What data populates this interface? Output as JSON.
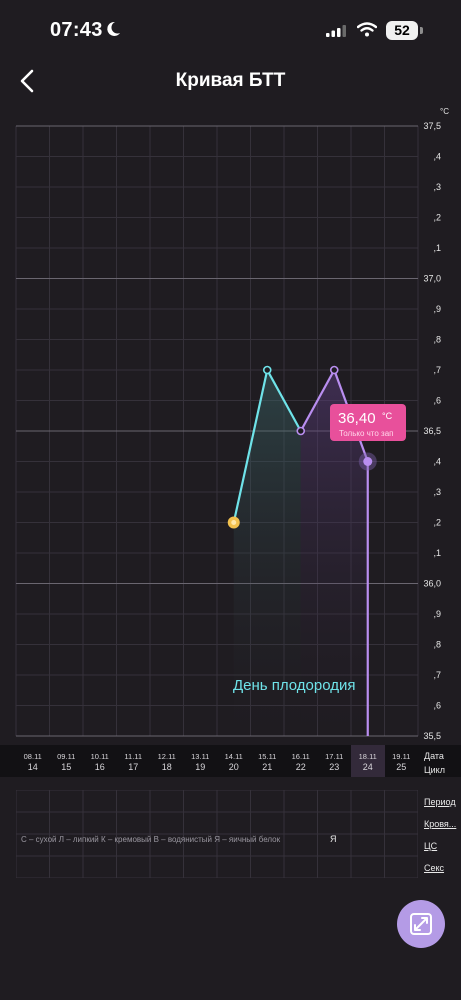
{
  "status": {
    "time": "07:43",
    "battery": "52"
  },
  "header": {
    "title": "Кривая БТТ"
  },
  "chart_data": {
    "type": "line",
    "title": "",
    "unit": "°C",
    "y_range": [
      35.5,
      37.5
    ],
    "y_ticks": [
      {
        "v": 37.5,
        "label": "37,5"
      },
      {
        "v": 37.4,
        "label": ",4"
      },
      {
        "v": 37.3,
        "label": ",3"
      },
      {
        "v": 37.2,
        "label": ",2"
      },
      {
        "v": 37.1,
        "label": ",1"
      },
      {
        "v": 37.0,
        "label": "37,0"
      },
      {
        "v": 36.9,
        "label": ",9"
      },
      {
        "v": 36.8,
        "label": ",8"
      },
      {
        "v": 36.7,
        "label": ",7"
      },
      {
        "v": 36.6,
        "label": ",6"
      },
      {
        "v": 36.5,
        "label": "36,5"
      },
      {
        "v": 36.4,
        "label": ",4"
      },
      {
        "v": 36.3,
        "label": ",3"
      },
      {
        "v": 36.2,
        "label": ",2"
      },
      {
        "v": 36.1,
        "label": ",1"
      },
      {
        "v": 36.0,
        "label": "36,0"
      },
      {
        "v": 35.9,
        "label": ",9"
      },
      {
        "v": 35.8,
        "label": ",8"
      },
      {
        "v": 35.7,
        "label": ",7"
      },
      {
        "v": 35.6,
        "label": ",6"
      },
      {
        "v": 35.5,
        "label": "35,5"
      }
    ],
    "dates": [
      "08.11",
      "09.11",
      "10.11",
      "11.11",
      "12.11",
      "13.11",
      "14.11",
      "15.11",
      "16.11",
      "17.11",
      "18.11",
      "19.11"
    ],
    "cycle_days": [
      "14",
      "15",
      "16",
      "17",
      "18",
      "19",
      "20",
      "21",
      "22",
      "23",
      "24",
      "25"
    ],
    "selected_index": 10,
    "points": [
      {
        "date": "14.11",
        "value": 36.2
      },
      {
        "date": "15.11",
        "value": 36.7
      },
      {
        "date": "16.11",
        "value": 36.5
      },
      {
        "date": "17.11",
        "value": 36.7
      },
      {
        "date": "18.11",
        "value": 36.4
      }
    ],
    "fertile_window": [
      "14.11",
      "17.11"
    ],
    "fertile_label": "День плодородия",
    "tooltip": {
      "value": "36,40",
      "unit": "°C",
      "note": "Только что зап"
    },
    "colors": {
      "line_1": "#6fe3e9",
      "line_2": "#b98ef0",
      "tooltip": "#e8509b",
      "marker": "#f2c14e"
    }
  },
  "date_row": {
    "date_label": "Дата",
    "cycle_label": "Цикл"
  },
  "observations": {
    "legend": "С – сухой Л – липкий К – кремовый В – водянистый Я – яичный белок",
    "mucus_mark": "Я",
    "rows": [
      "Период",
      "Кровя...",
      "ЦС",
      "Секс"
    ]
  }
}
